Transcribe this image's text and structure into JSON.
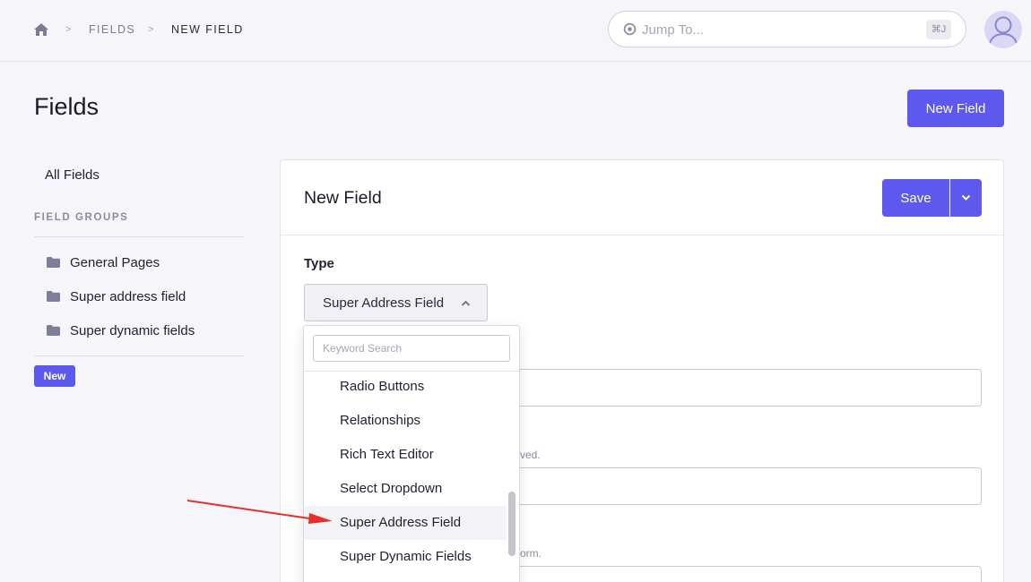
{
  "breadcrumb": {
    "home_icon": "home-icon",
    "separator": ">",
    "items": [
      "FIELDS",
      "NEW FIELD"
    ]
  },
  "search": {
    "placeholder": "Jump To...",
    "shortcut": "⌘J",
    "icon": "target-icon"
  },
  "user": {
    "avatar_icon": "user-avatar-icon"
  },
  "page": {
    "title": "Fields",
    "new_field_button": "New Field"
  },
  "sidebar": {
    "all_fields": "All Fields",
    "group_heading": "FIELD GROUPS",
    "groups": [
      "General Pages",
      "Super address field",
      "Super dynamic fields"
    ],
    "new_badge": "New"
  },
  "card": {
    "title": "New Field",
    "save_label": "Save",
    "type_label": "Type",
    "type_value": "Super Address Field",
    "hints": [
      "ved.",
      "orm."
    ]
  },
  "dropdown": {
    "search_placeholder": "Keyword Search",
    "options": [
      "Radio Buttons",
      "Relationships",
      "Rich Text Editor",
      "Select Dropdown",
      "Super Address Field",
      "Super Dynamic Fields"
    ],
    "selected_index": 4
  },
  "colors": {
    "accent": "#5d59ee",
    "background": "#f5f5fa",
    "annotation_arrow": "#e8302a"
  }
}
